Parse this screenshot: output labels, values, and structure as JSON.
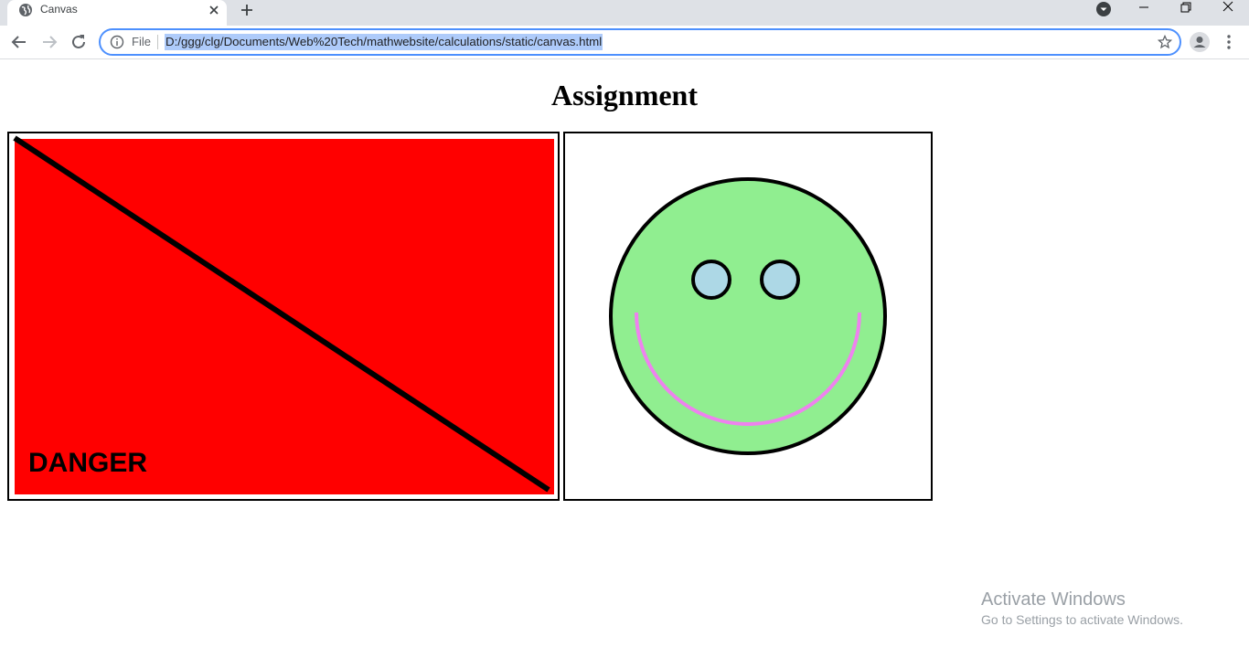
{
  "browser": {
    "tab": {
      "title": "Canvas"
    },
    "omnibox": {
      "scheme_label": "File",
      "url": "D:/ggg/clg/Documents/Web%20Tech/mathwebsite/calculations/static/canvas.html"
    }
  },
  "page": {
    "heading": "Assignment",
    "danger_canvas": {
      "label": "DANGER",
      "fill": "#ff0000",
      "line_color": "#000000"
    },
    "smiley_canvas": {
      "face_color": "#90ee90",
      "eye_color": "#add8e6",
      "smile_color": "#ee82ee",
      "outline_color": "#000000"
    }
  },
  "os_watermark": {
    "title": "Activate Windows",
    "subtitle": "Go to Settings to activate Windows."
  },
  "icons": [
    "globe-icon",
    "close-icon",
    "plus-icon",
    "back-arrow-icon",
    "forward-arrow-icon",
    "reload-icon",
    "info-icon",
    "star-icon",
    "account-icon",
    "more-vert-icon"
  ]
}
